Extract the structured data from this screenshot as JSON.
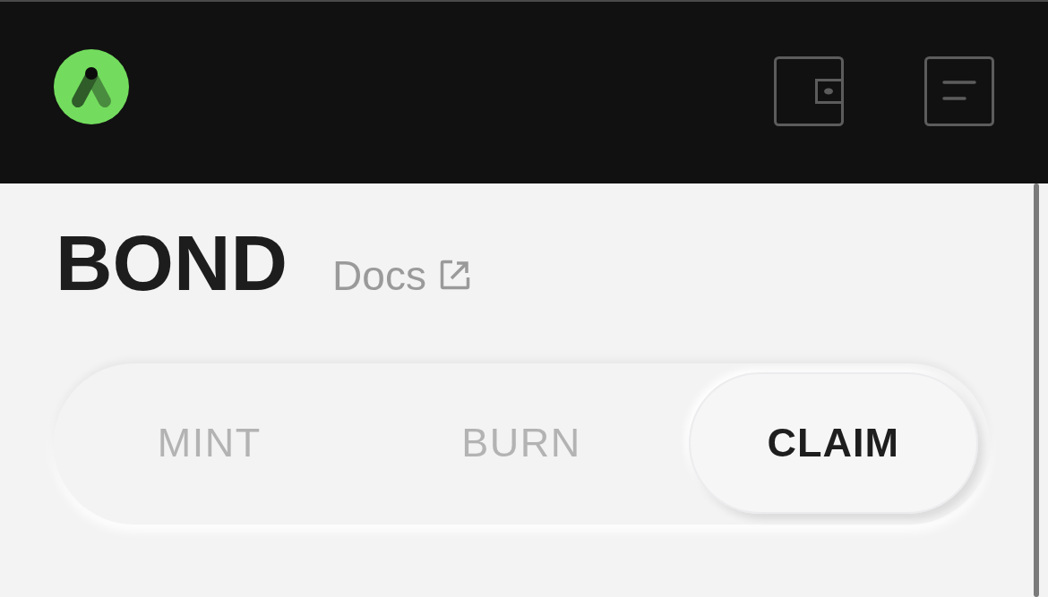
{
  "page": {
    "title": "BOND",
    "docs_link": "Docs"
  },
  "tabs": [
    {
      "label": "MINT",
      "selected": false
    },
    {
      "label": "BURN",
      "selected": false
    },
    {
      "label": "CLAIM",
      "selected": true
    }
  ]
}
